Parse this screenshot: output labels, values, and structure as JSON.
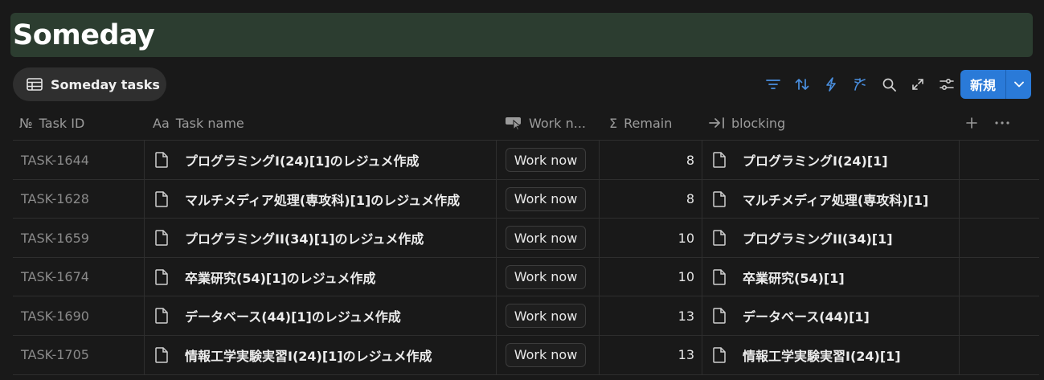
{
  "page": {
    "title": "Someday"
  },
  "view": {
    "tab_label": "Someday tasks"
  },
  "toolbar": {
    "icons": [
      "filter-icon",
      "sort-icon",
      "automation-icon",
      "ai-icon",
      "search-icon",
      "expand-icon",
      "settings-icon"
    ],
    "new_label": "新規"
  },
  "table": {
    "headers": {
      "task_id": "Task ID",
      "task_id_icon": "№",
      "task_name": "Task name",
      "task_name_icon": "Aa",
      "work_now": "Work n...",
      "remain": "Remain",
      "remain_icon": "Σ",
      "blocking": "blocking"
    },
    "rows": [
      {
        "id": "TASK-1644",
        "name": "プログラミングI(24)[1]のレジュメ作成",
        "button": "Work now",
        "remain": "8",
        "blocking": "プログラミングI(24)[1]"
      },
      {
        "id": "TASK-1628",
        "name": "マルチメディア処理(専攻科)[1]のレジュメ作成",
        "button": "Work now",
        "remain": "8",
        "blocking": "マルチメディア処理(専攻科)[1]"
      },
      {
        "id": "TASK-1659",
        "name": "プログラミングII(34)[1]のレジュメ作成",
        "button": "Work now",
        "remain": "10",
        "blocking": "プログラミングII(34)[1]"
      },
      {
        "id": "TASK-1674",
        "name": "卒業研究(54)[1]のレジュメ作成",
        "button": "Work now",
        "remain": "10",
        "blocking": "卒業研究(54)[1]"
      },
      {
        "id": "TASK-1690",
        "name": "データベース(44)[1]のレジュメ作成",
        "button": "Work now",
        "remain": "13",
        "blocking": "データベース(44)[1]"
      },
      {
        "id": "TASK-1705",
        "name": "情報工学実験実習I(24)[1]のレジュメ作成",
        "button": "Work now",
        "remain": "13",
        "blocking": "情報工学実験実習I(24)[1]"
      }
    ]
  },
  "colors": {
    "background": "#191919",
    "title_bg": "#2c3d30",
    "accent": "#2a7ad8",
    "toolbar_icon": "#4a8fe0"
  }
}
